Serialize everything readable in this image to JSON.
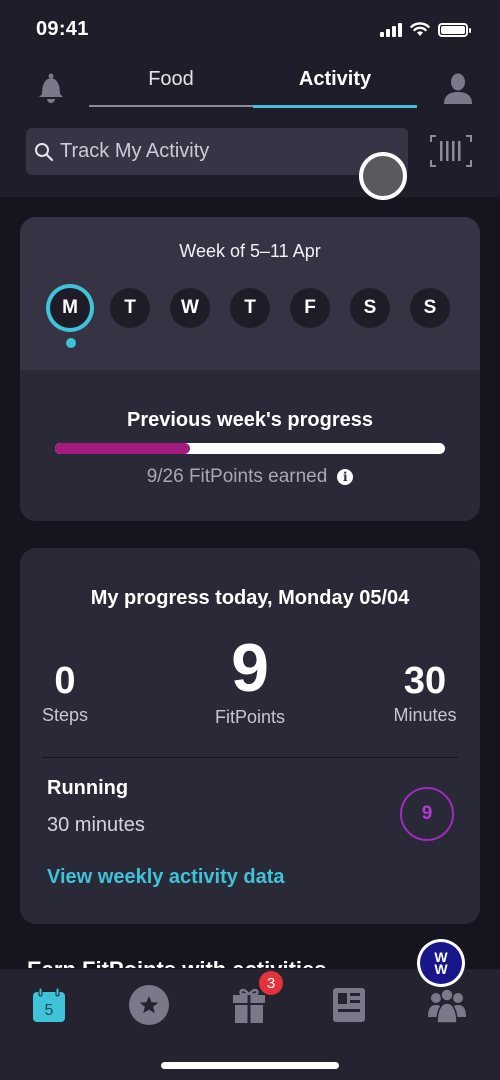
{
  "status_bar": {
    "time": "09:41"
  },
  "header": {
    "tabs": [
      {
        "label": "Food",
        "active": false
      },
      {
        "label": "Activity",
        "active": true
      }
    ],
    "search": {
      "placeholder": "Track My Activity",
      "value": ""
    }
  },
  "week": {
    "title": "Week of 5–11 Apr",
    "days": [
      {
        "label": "M",
        "selected": true
      },
      {
        "label": "T",
        "selected": false
      },
      {
        "label": "W",
        "selected": false
      },
      {
        "label": "T",
        "selected": false
      },
      {
        "label": "F",
        "selected": false
      },
      {
        "label": "S",
        "selected": false
      },
      {
        "label": "S",
        "selected": false
      }
    ],
    "previous": {
      "title": "Previous week's progress",
      "earned": 9,
      "goal": 26,
      "progress_fraction": 0.346,
      "caption": "9/26 FitPoints earned",
      "info_glyph": "i"
    }
  },
  "today": {
    "title": "My progress today, Monday 05/04",
    "stats": {
      "steps": {
        "value": "0",
        "label": "Steps"
      },
      "fitpoints": {
        "value": "9",
        "label": "FitPoints"
      },
      "minutes": {
        "value": "30",
        "label": "Minutes"
      }
    },
    "activity": {
      "name": "Running",
      "duration": "30 minutes",
      "points": "9"
    },
    "link": "View weekly activity data"
  },
  "section_heading": "Earn FitPoints with activities",
  "bottom_nav": {
    "calendar_day": "5",
    "gift_badge": "3",
    "logo_text": [
      "W",
      "W"
    ],
    "items": [
      "calendar-icon",
      "star-icon",
      "gift-icon",
      "news-icon",
      "community-icon"
    ]
  },
  "colors": {
    "accent": "#3ec3d9",
    "progress_fill": "#a51a7e",
    "points_purple": "#b23ad6",
    "badge_red": "#e3323c",
    "logo_blue": "#17168b"
  }
}
